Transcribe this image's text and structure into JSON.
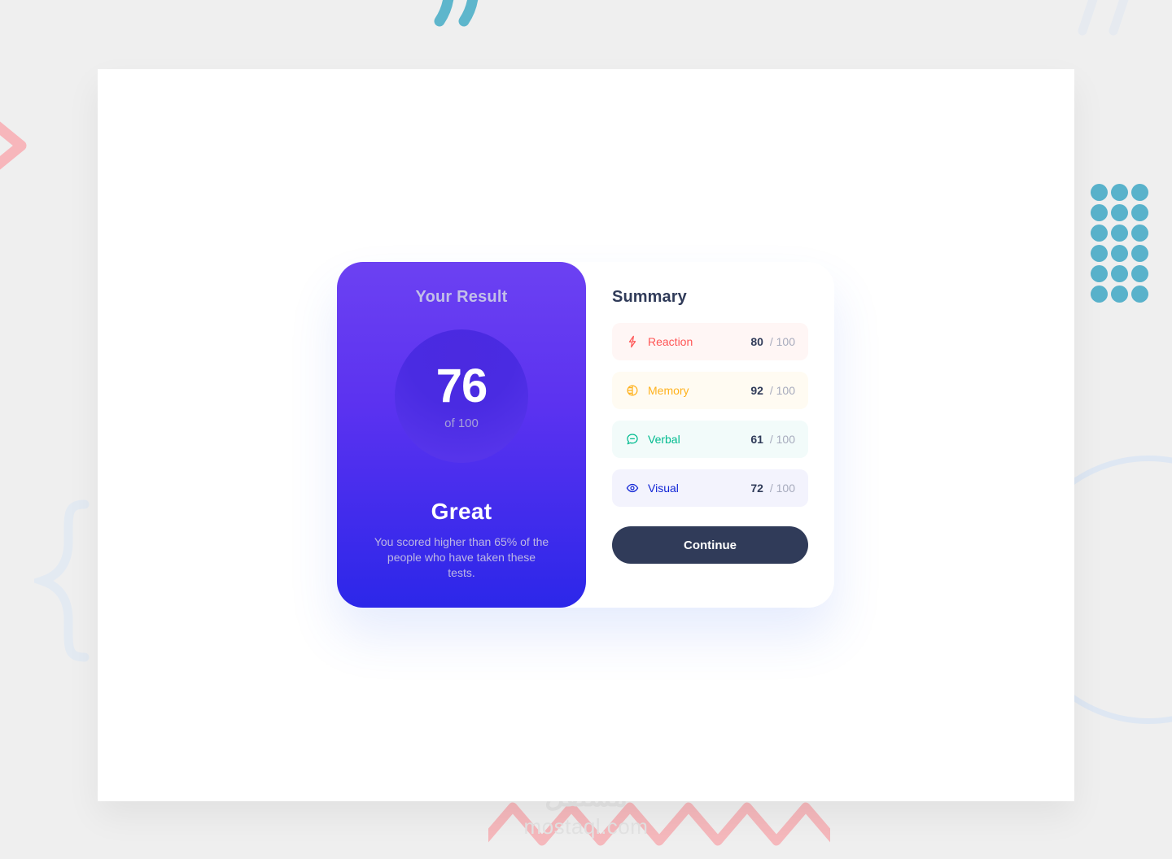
{
  "result": {
    "title": "Your Result",
    "score": "76",
    "score_total": "of 100",
    "rating": "Great",
    "description": "You scored higher than 65% of the people who have taken these tests.",
    "gradient_from": "#6c41f2",
    "gradient_to": "#2c27e9"
  },
  "summary": {
    "title": "Summary",
    "denominator": "/ 100",
    "categories": [
      {
        "label": "Reaction",
        "icon": "lightning-bolt-icon",
        "score": "80",
        "denominator": "/ 100",
        "accent": "#f55",
        "background": "#fff6f5"
      },
      {
        "label": "Memory",
        "icon": "brain-icon",
        "score": "92",
        "denominator": "/ 100",
        "accent": "#ffb21e",
        "background": "#fffbf2"
      },
      {
        "label": "Verbal",
        "icon": "chat-bubble-icon",
        "score": "61",
        "denominator": "/ 100",
        "accent": "#00bb8f",
        "background": "#f2fbfa"
      },
      {
        "label": "Visual",
        "icon": "eye-icon",
        "score": "72",
        "denominator": "/ 100",
        "accent": "#1125d6",
        "background": "#f3f3fd"
      }
    ],
    "continue_label": "Continue"
  },
  "watermark": {
    "arabic": "مستقل",
    "latin": "mostaql.com"
  },
  "decorations": {
    "quote_teal_color": "#5eb6cc",
    "quote_blue_color": "#d8e4f4",
    "chevron_pink_color": "#f7b6bb",
    "brace_blue_color": "#dbe6f5",
    "circle_blue_color": "#d8e4f4",
    "dot_grid_color": "#59b2cb",
    "dot_grid_rows": 6,
    "dot_grid_cols": 3,
    "zigzag_color": "#f5b8bc"
  }
}
